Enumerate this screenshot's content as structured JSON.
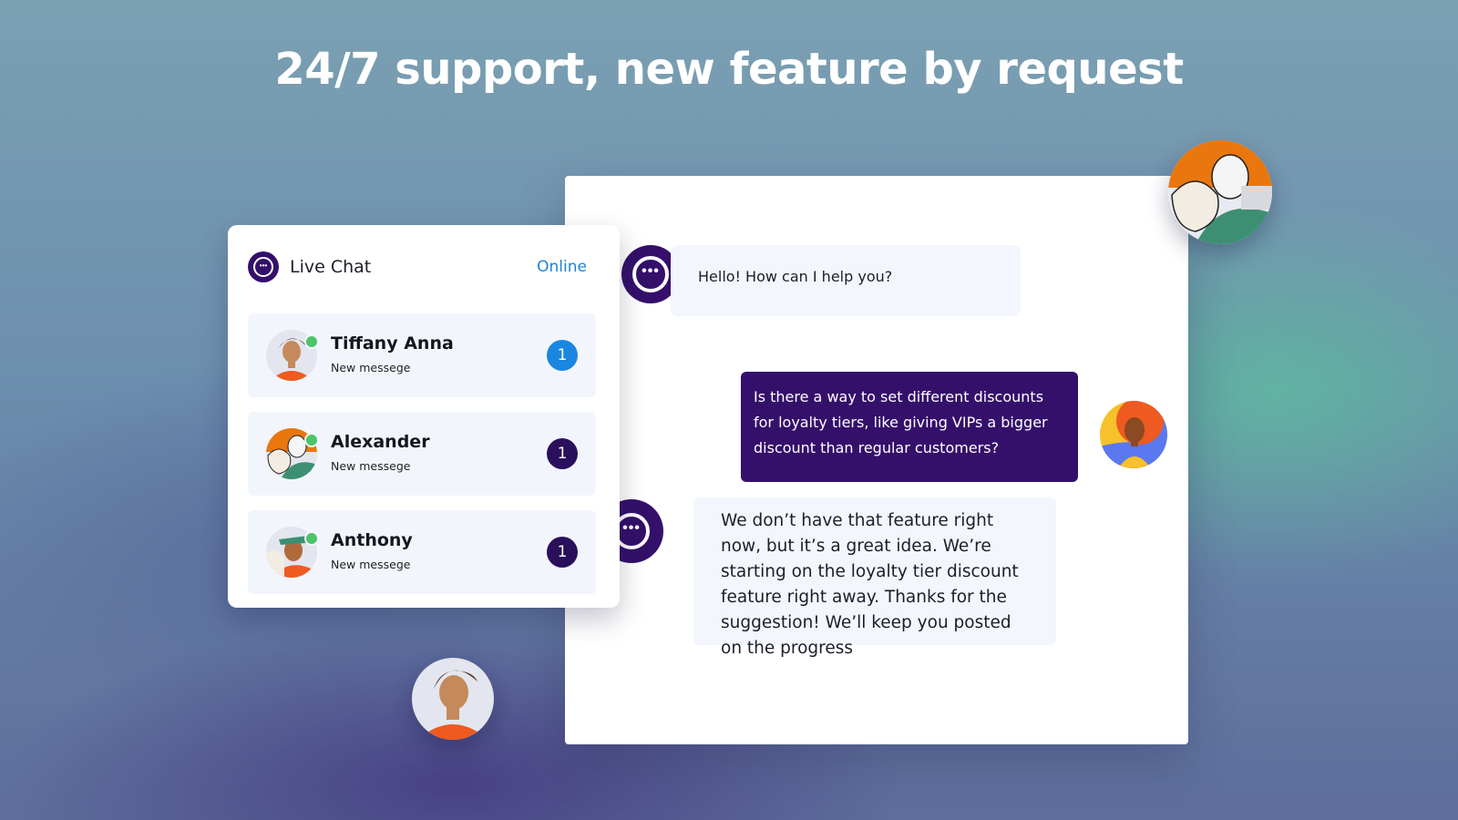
{
  "headline": "24/7 support, new feature by request",
  "live_chat": {
    "title": "Live Chat",
    "status": "Online",
    "status_color": "#1c84d6",
    "contacts": [
      {
        "name": "Tiffany Anna",
        "subtitle": "New messege",
        "unread": "1",
        "badge_color": "#1a86e0",
        "online": true
      },
      {
        "name": "Alexander",
        "subtitle": "New messege",
        "unread": "1",
        "badge_color": "#2a0f5c",
        "online": true
      },
      {
        "name": "Anthony",
        "subtitle": "New messege",
        "unread": "1",
        "badge_color": "#2a0f5c",
        "online": true
      }
    ]
  },
  "conversation": {
    "messages": [
      {
        "sender": "agent",
        "text": "Hello! How can I help you?"
      },
      {
        "sender": "user",
        "text": "Is there a way to set different discounts for loyalty tiers, like giving VIPs a bigger discount than regular customers?"
      },
      {
        "sender": "agent",
        "text": "We don’t have that feature right now, but it’s a great idea. We’re starting on the loyalty tier discount feature right away. Thanks for the suggestion! We’ll keep you posted on the progress"
      }
    ]
  },
  "icons": {
    "agent_avatar": "chat-bubble-ellipsis-icon",
    "dots": "•••"
  },
  "colors": {
    "brand": "#34106a",
    "bubble_light": "#f3f6fc",
    "online": "#4cc46a"
  }
}
